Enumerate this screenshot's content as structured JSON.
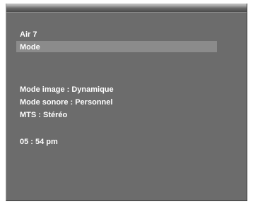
{
  "osd": {
    "channel": "Air  7",
    "menu_item": "Mode",
    "picture_mode": "Mode image : Dynamique",
    "sound_mode": "Mode sonore : Personnel",
    "mts": "MTS : Stéréo",
    "clock": "05 : 54 pm"
  }
}
